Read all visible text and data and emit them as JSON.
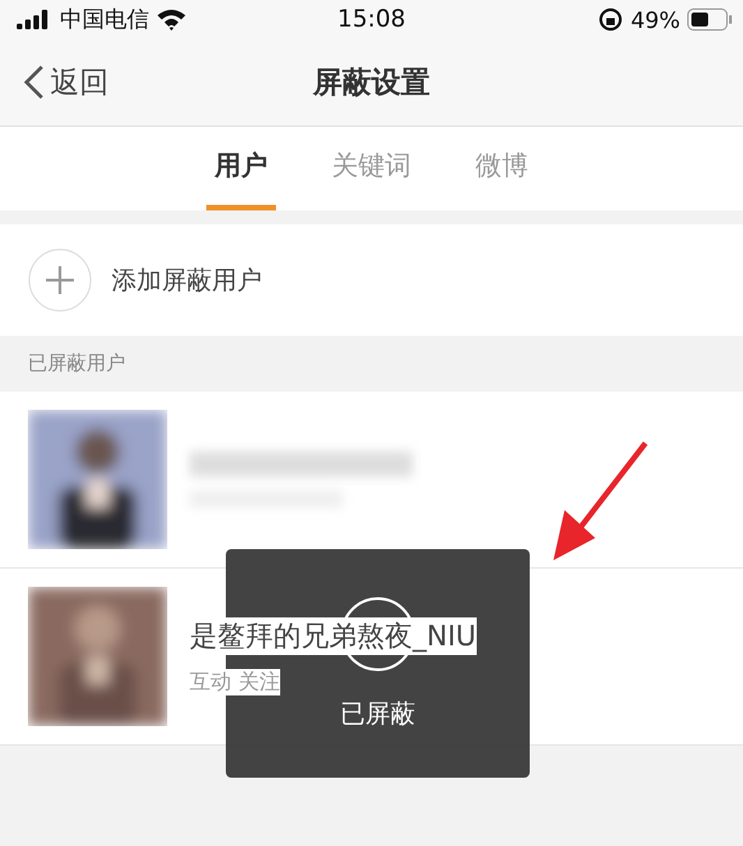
{
  "status_bar": {
    "carrier": "中国电信",
    "time": "15:08",
    "battery": "49%"
  },
  "nav": {
    "back": "返回",
    "title": "屏蔽设置"
  },
  "tabs": [
    {
      "label": "用户",
      "selected": true
    },
    {
      "label": "关键词",
      "selected": false
    },
    {
      "label": "微博",
      "selected": false
    }
  ],
  "add_button": {
    "label": "添加屏蔽用户"
  },
  "section_header": "已屏蔽用户",
  "users": [
    {
      "avatar": {
        "kind": "picture"
      }
    },
    {
      "avatar": {
        "kind": "picture"
      },
      "name": "是鳌拜的兄弟熬夜_NIU",
      "subtitle": "互动 关注"
    }
  ],
  "toast": {
    "message": "已屏蔽"
  }
}
